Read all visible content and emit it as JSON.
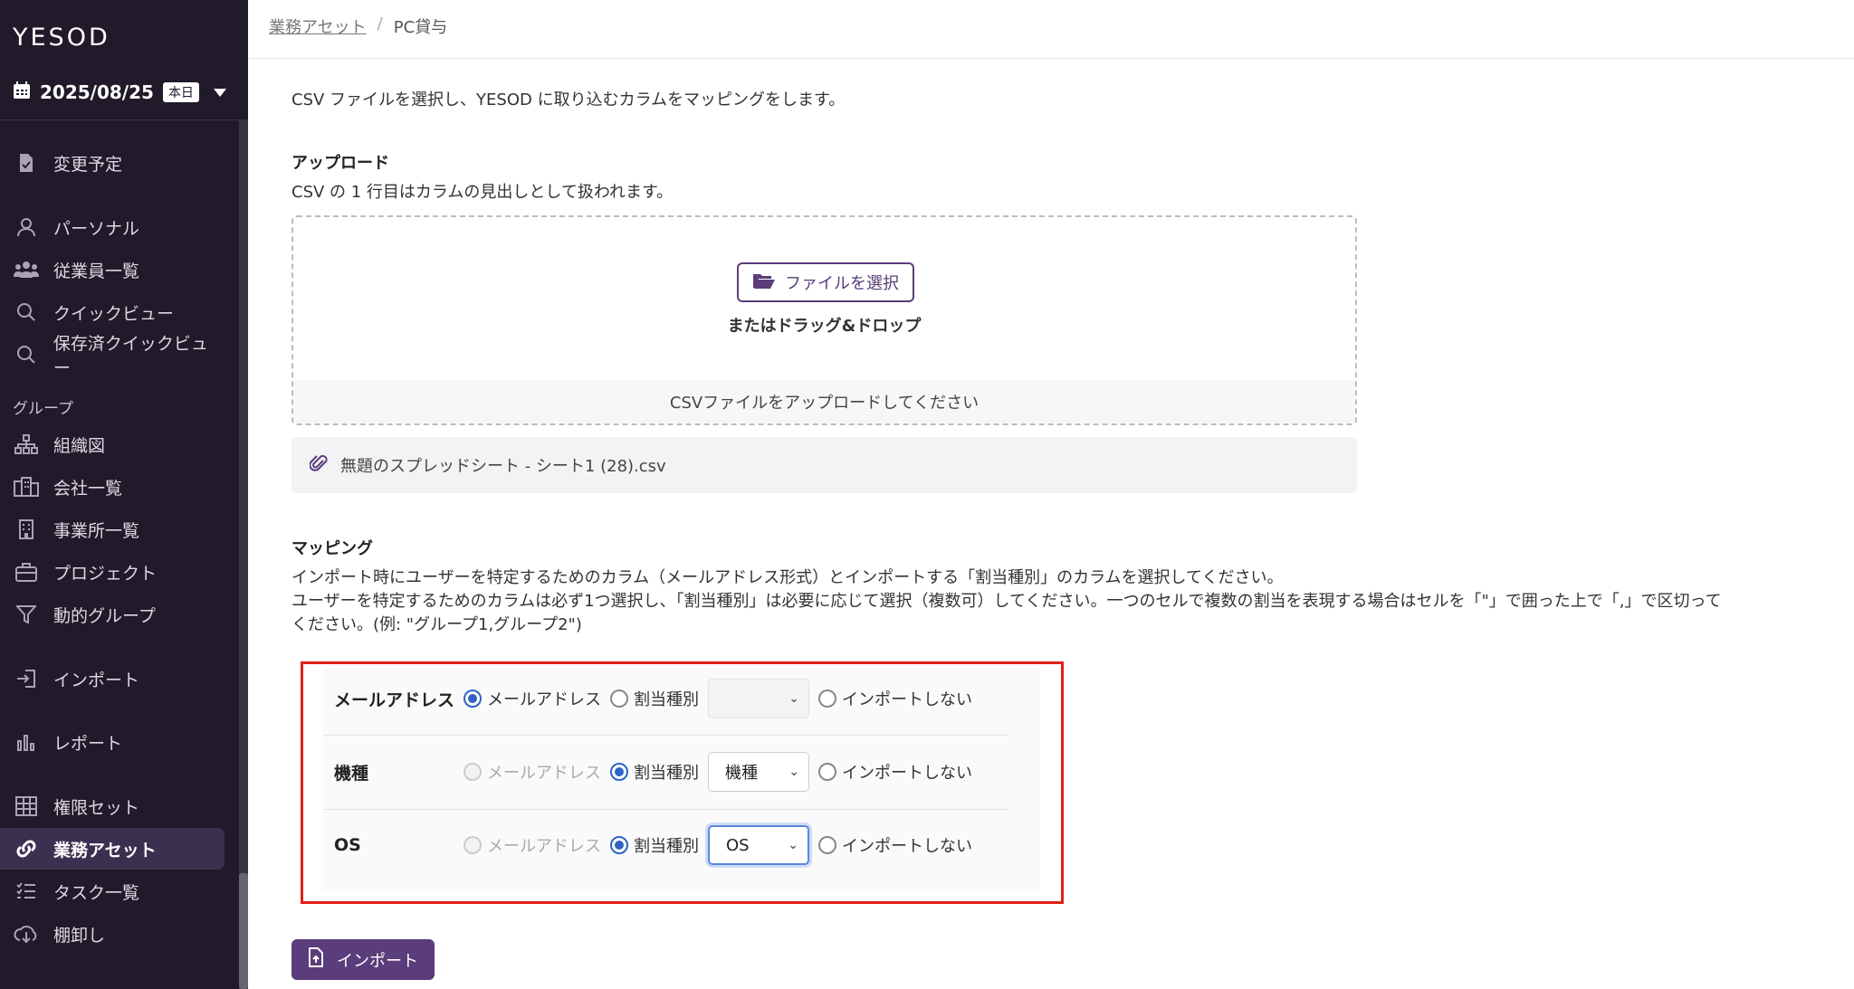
{
  "sidebar": {
    "logo": "YESOD",
    "date": "2025/08/25",
    "today_badge": "本日",
    "items": [
      {
        "label": "変更予定",
        "icon": "file-check-icon"
      },
      {
        "label": "パーソナル",
        "icon": "user-icon"
      },
      {
        "label": "従業員一覧",
        "icon": "users-icon"
      },
      {
        "label": "クイックビュー",
        "icon": "search-icon"
      },
      {
        "label": "保存済クイックビュー",
        "icon": "search-icon"
      },
      {
        "label": "組織図",
        "icon": "org-chart-icon"
      },
      {
        "label": "会社一覧",
        "icon": "building-icon"
      },
      {
        "label": "事業所一覧",
        "icon": "office-icon"
      },
      {
        "label": "プロジェクト",
        "icon": "briefcase-icon"
      },
      {
        "label": "動的グループ",
        "icon": "filter-icon"
      },
      {
        "label": "インポート",
        "icon": "import-icon"
      },
      {
        "label": "レポート",
        "icon": "bar-chart-icon"
      },
      {
        "label": "権限セット",
        "icon": "grid-icon"
      },
      {
        "label": "業務アセット",
        "icon": "link-icon"
      },
      {
        "label": "タスク一覧",
        "icon": "list-icon"
      },
      {
        "label": "棚卸し",
        "icon": "cloud-download-icon"
      }
    ],
    "group_label": "グループ",
    "active_item": "業務アセット"
  },
  "breadcrumb": {
    "parent": "業務アセット",
    "separator": "/",
    "current": "PC貸与"
  },
  "intro": "CSV ファイルを選択し、YESOD に取り込むカラムをマッピングをします。",
  "upload": {
    "title": "アップロード",
    "description": "CSV の 1 行目はカラムの見出しとして扱われます。",
    "file_button": "ファイルを選択",
    "drag_drop": "またはドラッグ&ドロップ",
    "hint": "CSVファイルをアップロードしてください",
    "file_name": "無題のスプレッドシート - シート1 (28).csv"
  },
  "mapping": {
    "title": "マッピング",
    "description_1": "インポート時にユーザーを特定するためのカラム（メールアドレス形式）とインポートする「割当種別」のカラムを選択してください。",
    "description_2": "ユーザーを特定するためのカラムは必ず1つ選択し、「割当種別」は必要に応じて選択（複数可）してください。一つのセルで複数の割当を表現する場合はセルを「\"」で囲った上で「,」で区切って",
    "description_3": "ください。(例: \"グループ1,グループ2\")",
    "option_email": "メールアドレス",
    "option_assign": "割当種別",
    "option_skip": "インポートしない",
    "rows": [
      {
        "column": "メールアドレス",
        "selected": "メールアドレス",
        "assign_value": ""
      },
      {
        "column": "機種",
        "selected": "割当種別",
        "assign_value": "機種"
      },
      {
        "column": "OS",
        "selected": "割当種別",
        "assign_value": "OS"
      }
    ]
  },
  "import_button": "インポート",
  "colors": {
    "sidebar_bg": "#211a2a",
    "primary": "#5a3d7a",
    "radio_selected": "#2f62c4",
    "highlight_border": "#e0201a"
  }
}
